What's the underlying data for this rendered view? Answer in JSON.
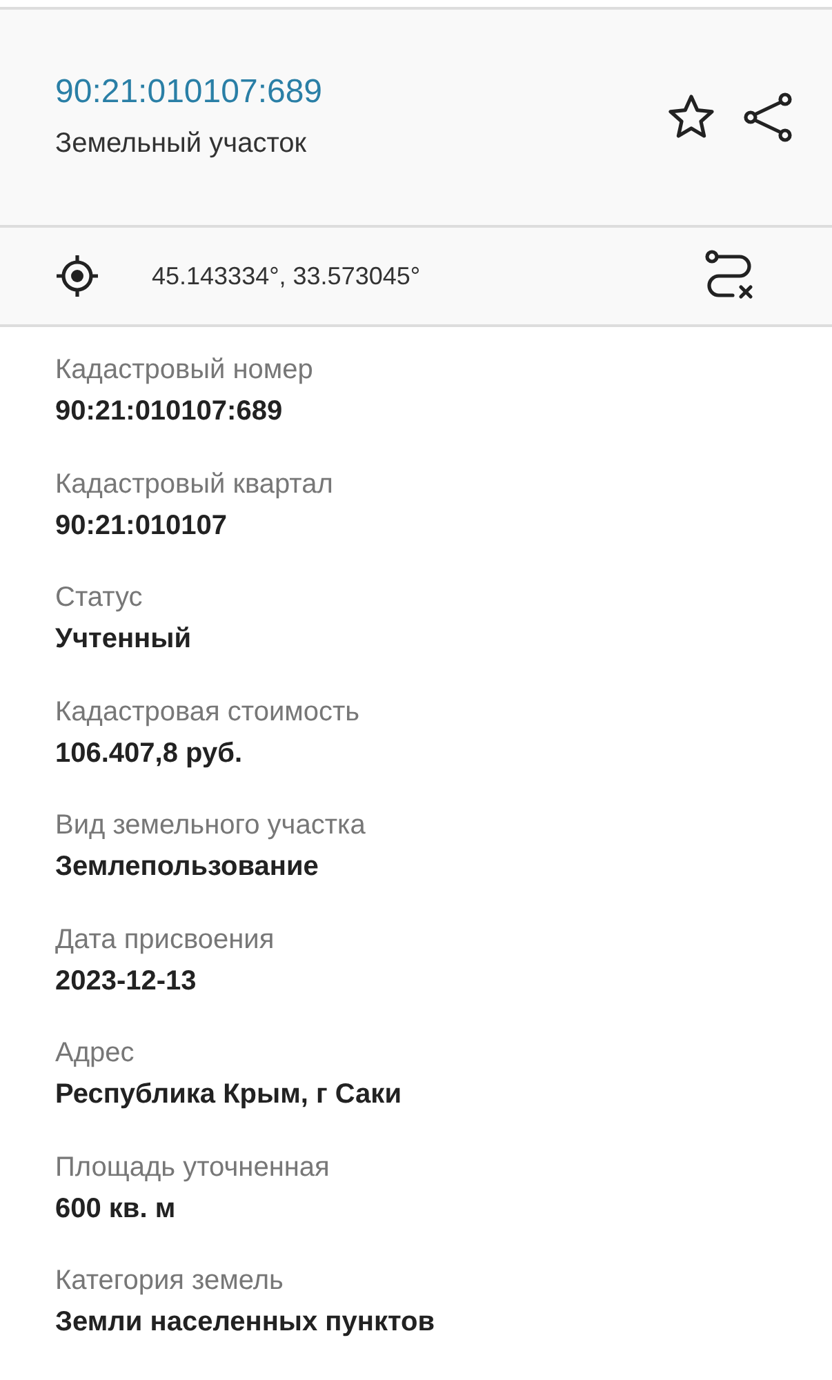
{
  "header": {
    "title": "90:21:010107:689",
    "subtitle": "Земельный участок"
  },
  "coordinates": {
    "text": "45.143334°, 33.573045°"
  },
  "fields": [
    {
      "label": "Кадастровый номер",
      "value": "90:21:010107:689"
    },
    {
      "label": "Кадастровый квартал",
      "value": "90:21:010107"
    },
    {
      "label": "Статус",
      "value": "Учтенный"
    },
    {
      "label": "Кадастровая стоимость",
      "value": "106.407,8 руб."
    },
    {
      "label": "Вид земельного участка",
      "value": "Землепользование"
    },
    {
      "label": "Дата присвоения",
      "value": "2023-12-13"
    },
    {
      "label": "Адрес",
      "value": "Республика Крым, г Саки"
    },
    {
      "label": "Площадь уточненная",
      "value": "600 кв. м"
    },
    {
      "label": "Категория земель",
      "value": "Земли населенных пунктов"
    }
  ]
}
